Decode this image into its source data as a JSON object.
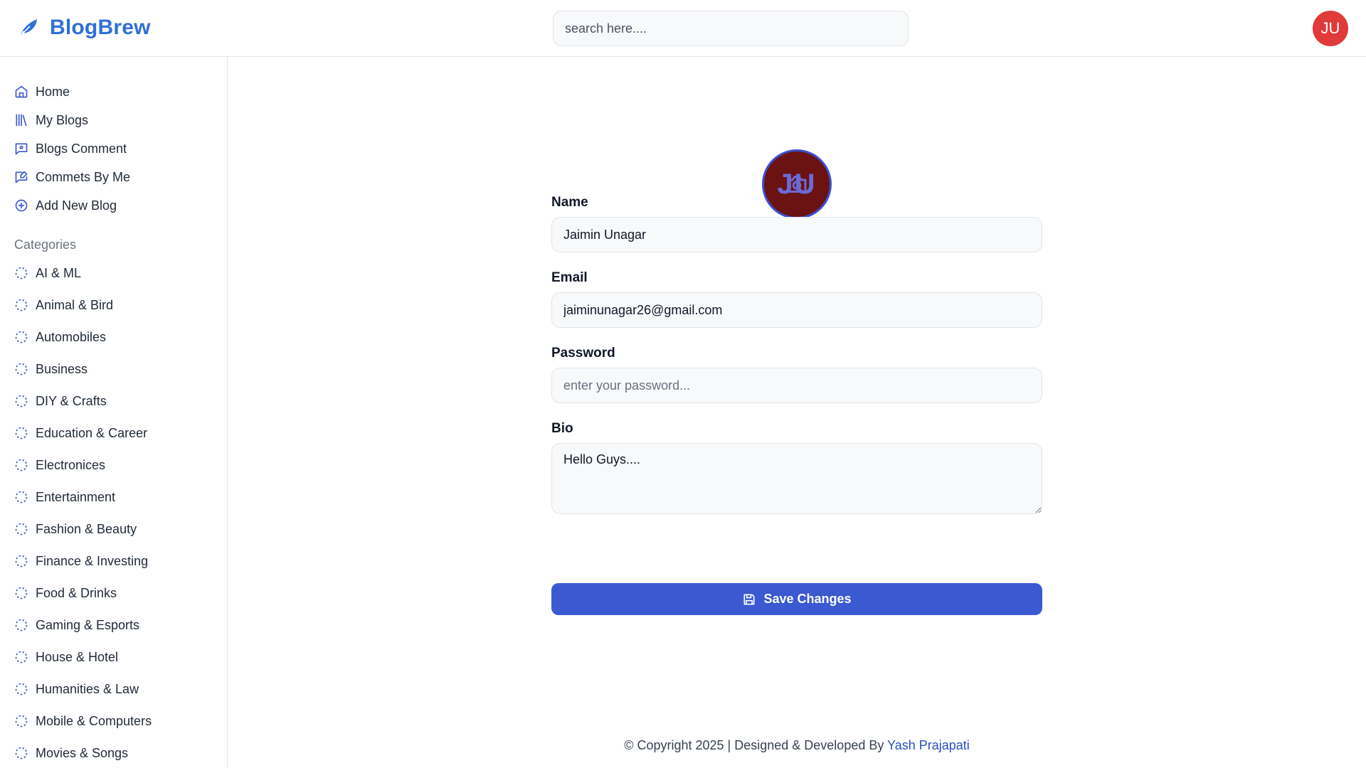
{
  "header": {
    "brand": "BlogBrew",
    "search_placeholder": "search here....",
    "user_initials": "JU"
  },
  "colors": {
    "brand": "#2f6fd6",
    "accent": "#3b59d0",
    "avatar_bg": "#e03a3a"
  },
  "sidebar": {
    "nav": [
      {
        "label": "Home",
        "icon": "home-icon"
      },
      {
        "label": "My Blogs",
        "icon": "library-icon"
      },
      {
        "label": "Blogs Comment",
        "icon": "message-square-icon"
      },
      {
        "label": "Commets By Me",
        "icon": "message-edit-icon"
      },
      {
        "label": "Add New Blog",
        "icon": "plus-circle-icon"
      }
    ],
    "categories_heading": "Categories",
    "categories": [
      "AI & ML",
      "Animal & Bird",
      "Automobiles",
      "Business",
      "DIY & Crafts",
      "Education & Career",
      "Electronices",
      "Entertainment",
      "Fashion & Beauty",
      "Finance & Investing",
      "Food & Drinks",
      "Gaming & Esports",
      "House & Hotel",
      "Humanities & Law",
      "Mobile & Computers",
      "Movies & Songs"
    ]
  },
  "profile": {
    "avatar_initials": "JU",
    "name_label": "Name",
    "name_value": "Jaimin Unagar",
    "email_label": "Email",
    "email_value": "jaiminunagar26@gmail.com",
    "password_label": "Password",
    "password_placeholder": "enter your password...",
    "bio_label": "Bio",
    "bio_value": "Hello Guys....",
    "save_label": "Save Changes"
  },
  "footer": {
    "text": "© Copyright 2025 | Designed & Developed By",
    "author": "Yash Prajapati"
  }
}
